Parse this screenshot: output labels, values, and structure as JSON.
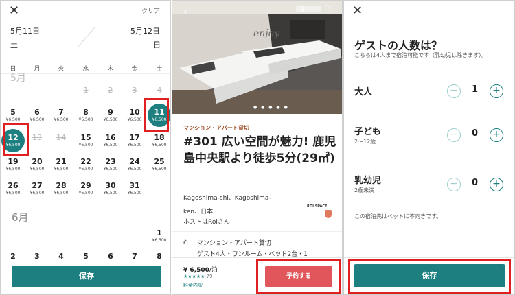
{
  "panel1": {
    "clear_label": "クリア",
    "start_date": "5月11日",
    "start_weekday": "土",
    "end_date": "5月12日",
    "end_weekday": "日",
    "weekdays": [
      "日",
      "月",
      "火",
      "水",
      "木",
      "金",
      "土"
    ],
    "month_may": "5月",
    "month_june": "6月",
    "price": "¥6,500",
    "days_row1": [
      "1",
      "2",
      "3",
      "4"
    ],
    "days_row2": [
      "5",
      "6",
      "7",
      "8",
      "9",
      "10",
      "11"
    ],
    "days_row3": [
      "12",
      "13",
      "14",
      "15",
      "16",
      "17",
      "18"
    ],
    "days_row4": [
      "19",
      "20",
      "21",
      "22",
      "23",
      "24",
      "25"
    ],
    "days_row5": [
      "26",
      "27",
      "28",
      "29",
      "30",
      "31"
    ],
    "june_day1": "1",
    "june_row2": [
      "2",
      "3",
      "4",
      "5",
      "6",
      "7",
      "8"
    ],
    "save_label": "保存",
    "accent_color": "#1d7f80"
  },
  "panel2": {
    "category": "マンション・アパート貸切",
    "title": "#301 広い空間が魅力! 鹿児島中央駅より徒歩5分(29㎡)",
    "location_line1": "Kagoshima-shi、Kagoshima-",
    "location_line2": "ken、日本",
    "host": "ホストはRoiさん",
    "host_logo_text": "ROI SPACE",
    "property_type": "マンション・アパート貸切",
    "property_detail": "ゲスト4人・ワンルーム・ベッド2台・1",
    "price": "¥ 6,500",
    "price_unit": "/泊",
    "stars": "★★★★★",
    "review_count": "79",
    "fee_label": "料金内訳",
    "reserve_label": "予約する",
    "reserve_color": "#e0565b",
    "wall_text": "enjoy"
  },
  "panel3": {
    "heading": "ゲストの人数は？",
    "note": "こちらは4人まで宿泊可能です（乳幼児は除きます）。",
    "adults_label": "大人",
    "adults_count": "1",
    "children_label": "子ども",
    "children_sub": "2〜12歳",
    "children_count": "0",
    "infants_label": "乳幼児",
    "infants_sub": "2歳未満",
    "infants_count": "0",
    "pet_note": "この宿泊先はペットに不向きです。",
    "save_label": "保存",
    "minus": "−",
    "plus": "+"
  }
}
